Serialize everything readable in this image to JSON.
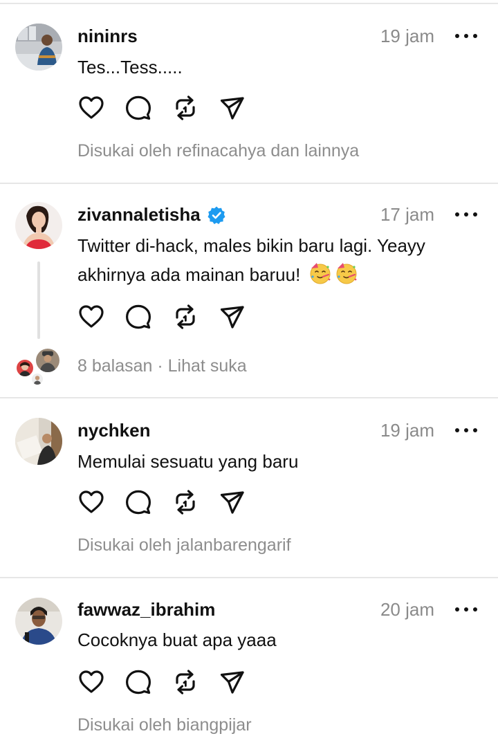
{
  "posts": [
    {
      "username": "nininrs",
      "verified": false,
      "time": "19 jam",
      "text": "Tes...Tess.....",
      "meta": "Disukai oleh refinacahya dan lainnya"
    },
    {
      "username": "zivannaletisha",
      "verified": true,
      "time": "17 jam",
      "text": "Twitter di-hack, males bikin baru lagi. Yeayy akhirnya ada mainan baruu!",
      "emojis": [
        "partying-face-emoji",
        "partying-face-emoji"
      ],
      "replies": "8 balasan",
      "separator": " · ",
      "view_likes": "Lihat suka"
    },
    {
      "username": "nychken",
      "verified": false,
      "time": "19 jam",
      "text": "Memulai sesuatu yang baru",
      "meta": "Disukai oleh jalanbarengarif"
    },
    {
      "username": "fawwaz_ibrahim",
      "verified": false,
      "time": "20 jam",
      "text": "Cocoknya buat apa yaaa",
      "meta": "Disukai oleh biangpijar"
    }
  ],
  "icons": [
    "heart-icon",
    "comment-icon",
    "repost-icon",
    "share-icon",
    "more-icon",
    "verified-badge-icon"
  ],
  "colors": {
    "text": "#111111",
    "muted": "#8a8a8a",
    "divider": "#e6e6e6",
    "verified": "#1d9bf0"
  }
}
